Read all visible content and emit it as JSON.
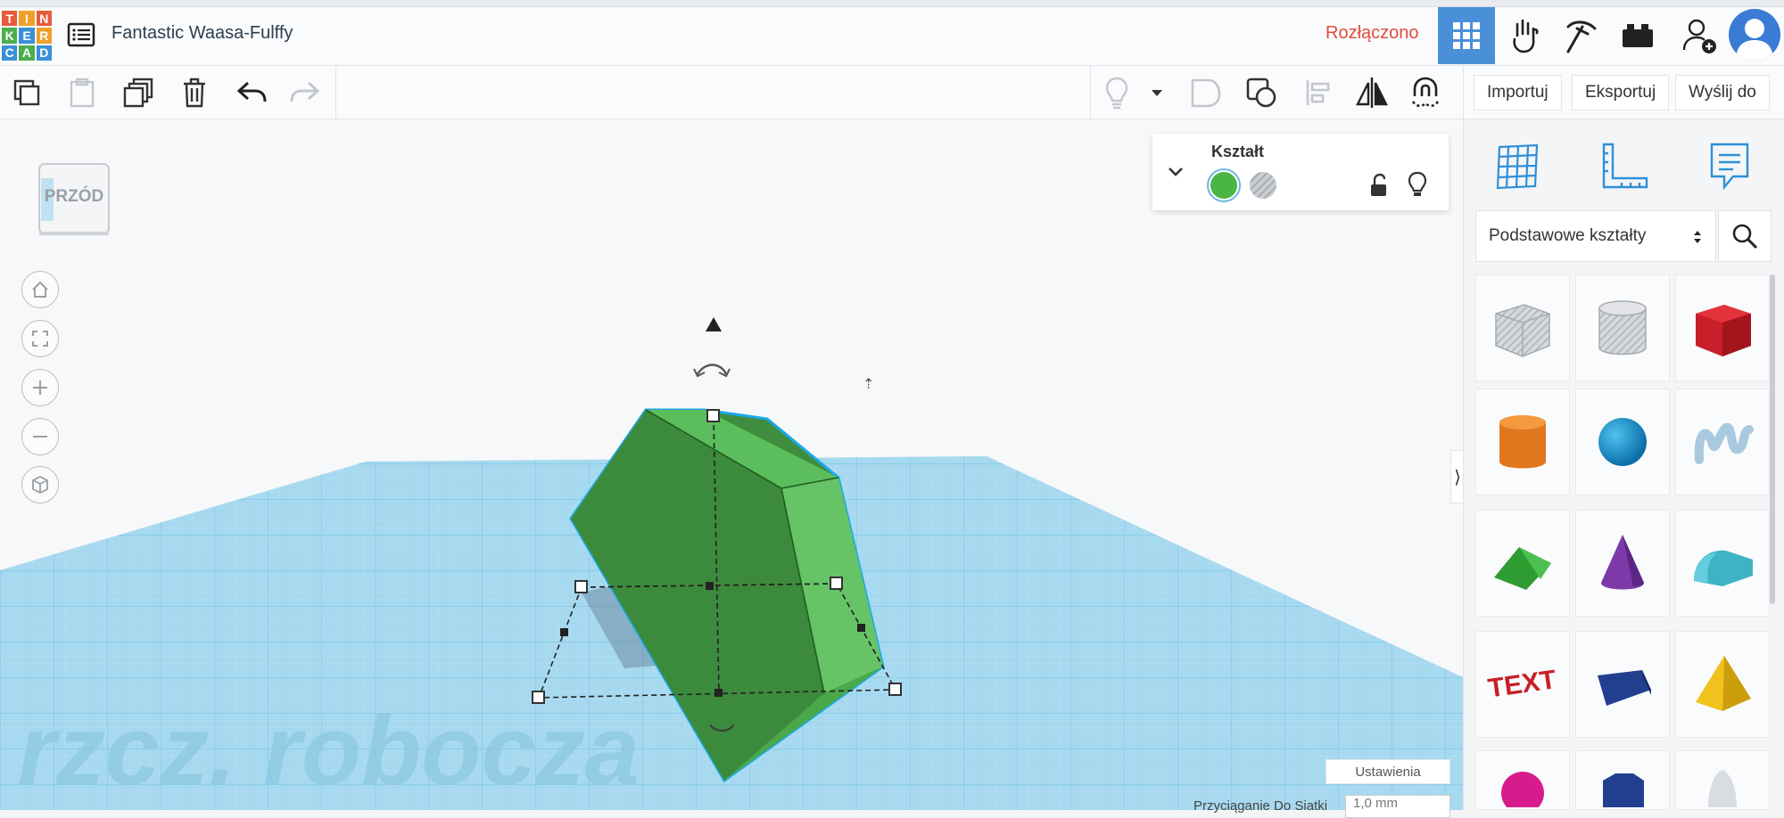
{
  "app": {
    "logo_letters": [
      "T",
      "I",
      "N",
      "K",
      "E",
      "R",
      "C",
      "A",
      "D"
    ],
    "project_title": "Fantastic Waasa-Fulffy",
    "connection_status": "Rozłączono"
  },
  "top_nav": [
    {
      "name": "3d-design-icon",
      "active": true
    },
    {
      "name": "blocks-icon",
      "active": false
    },
    {
      "name": "codeblocks-icon",
      "active": false
    },
    {
      "name": "lego-bricks-icon",
      "active": false
    },
    {
      "name": "add-user-icon",
      "active": false
    }
  ],
  "toolbar": {
    "import_label": "Importuj",
    "export_label": "Eksportuj",
    "send_label": "Wyślij do"
  },
  "viewcube": {
    "face_label": "PRZÓD"
  },
  "inspector": {
    "title": "Kształt",
    "solid_color": "#4bb543"
  },
  "workplane": {
    "watermark": "rzcz. robocza",
    "settings_label": "Ustawienia",
    "snap_label": "Przyciąganie Do Siatki",
    "snap_value": "1,0 mm"
  },
  "right_panel": {
    "category": "Podstawowe kształty",
    "text_shape_label": "TEXT"
  },
  "colors": {
    "accent": "#4a90d9",
    "status_red": "#e24b3b",
    "grid_blue": "#8fd0ec",
    "shape_green": "#5cb85c"
  }
}
